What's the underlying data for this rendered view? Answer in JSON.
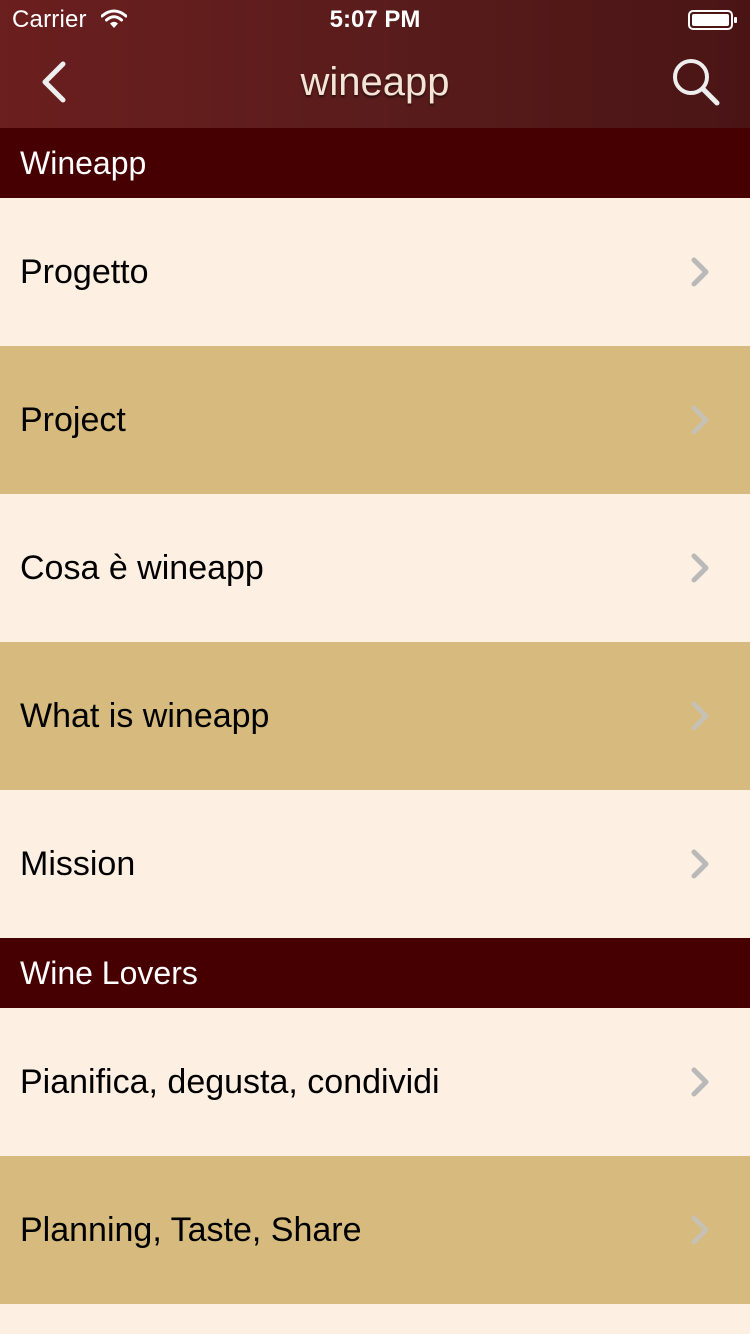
{
  "status_bar": {
    "carrier": "Carrier",
    "time": "5:07 PM",
    "wifi_icon": "wifi-icon",
    "battery_icon": "battery-icon"
  },
  "nav_bar": {
    "title": "wineapp",
    "back_icon": "chevron-left-icon",
    "search_icon": "search-icon"
  },
  "sections": [
    {
      "header": "Wineapp",
      "items": [
        {
          "label": "Progetto"
        },
        {
          "label": "Project"
        },
        {
          "label": "Cosa è wineapp"
        },
        {
          "label": "What is wineapp"
        },
        {
          "label": "Mission"
        }
      ]
    },
    {
      "header": "Wine Lovers",
      "items": [
        {
          "label": "Pianifica, degusta, condividi"
        },
        {
          "label": "Planning, Taste, Share"
        },
        {
          "label": ""
        }
      ]
    }
  ],
  "colors": {
    "nav_bar": "#5a1c1c",
    "section_header": "#470002",
    "row_light": "#fdefe2",
    "row_dark": "#d6ba7e",
    "chevron": "#b9b9b9"
  }
}
